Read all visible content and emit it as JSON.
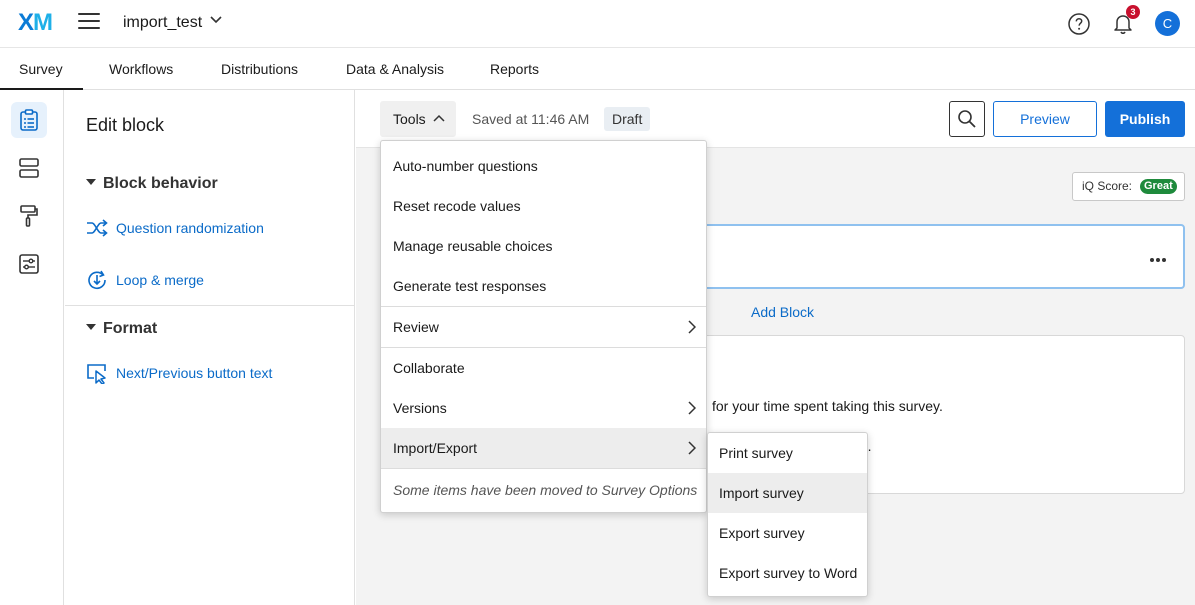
{
  "app": {
    "logo_x": "X",
    "logo_m": "M",
    "project_title": "import_test",
    "notification_count": "3",
    "avatar_initial": "C"
  },
  "nav_tabs": [
    {
      "label": "Survey",
      "active": true
    },
    {
      "label": "Workflows"
    },
    {
      "label": "Distributions"
    },
    {
      "label": "Data & Analysis"
    },
    {
      "label": "Reports"
    }
  ],
  "rail_icons": [
    "survey-flow-icon",
    "blocks-icon",
    "look-and-feel-icon",
    "survey-options-icon"
  ],
  "edit_panel": {
    "title": "Edit block",
    "block_behavior": {
      "heading": "Block behavior",
      "links": [
        "Question randomization",
        "Loop & merge"
      ]
    },
    "format": {
      "heading": "Format",
      "links": [
        "Next/Previous button text"
      ]
    }
  },
  "toolbar": {
    "tools_label": "Tools",
    "saved_text": "Saved at 11:46 AM",
    "draft_label": "Draft",
    "preview_label": "Preview",
    "publish_label": "Publish"
  },
  "canvas": {
    "iq_score_label": "iQ Score:",
    "iq_score_value": "Great",
    "add_block_label": "Add Block",
    "end_text_1": "for your time spent taking this survey.",
    "end_text_2": "ed."
  },
  "tools_menu": {
    "items": [
      "Auto-number questions",
      "Reset recode values",
      "Manage reusable choices",
      "Generate test responses",
      "Review",
      "Collaborate",
      "Versions",
      "Import/Export"
    ],
    "note": "Some items have been moved to Survey Options"
  },
  "import_export_submenu": {
    "items": [
      "Print survey",
      "Import survey",
      "Export survey",
      "Export survey to Word"
    ]
  },
  "colors": {
    "accent": "#1470d9",
    "link": "#0b6bc8",
    "badge": "#c8102e",
    "iq_great": "#1e8a3c"
  }
}
